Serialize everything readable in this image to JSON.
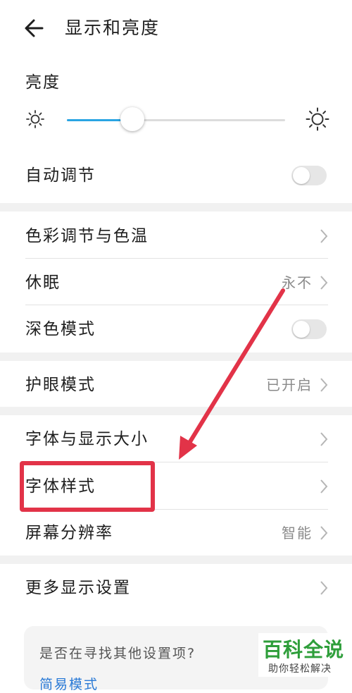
{
  "header": {
    "title": "显示和亮度",
    "back_icon": "arrow-left-icon"
  },
  "brightness": {
    "label": "亮度",
    "level": 0.3
  },
  "auto_adjust": {
    "label": "自动调节",
    "on": false
  },
  "rows": {
    "color_temp": {
      "label": "色彩调节与色温"
    },
    "sleep": {
      "label": "休眠",
      "value": "永不"
    },
    "dark_mode": {
      "label": "深色模式",
      "on": false
    },
    "eye_comfort": {
      "label": "护眼模式",
      "value": "已开启"
    },
    "font_size": {
      "label": "字体与显示大小"
    },
    "font_style": {
      "label": "字体样式"
    },
    "resolution": {
      "label": "屏幕分辨率",
      "value": "智能"
    },
    "more": {
      "label": "更多显示设置"
    }
  },
  "suggestion": {
    "question": "是否在寻找其他设置项?",
    "link": "简易模式"
  },
  "watermark": {
    "main": "百科全说",
    "sub": "助你轻松解决"
  },
  "colors": {
    "accent": "#2aa5e3",
    "annotation": "#e23348",
    "watermark": "#2e9e3a"
  }
}
